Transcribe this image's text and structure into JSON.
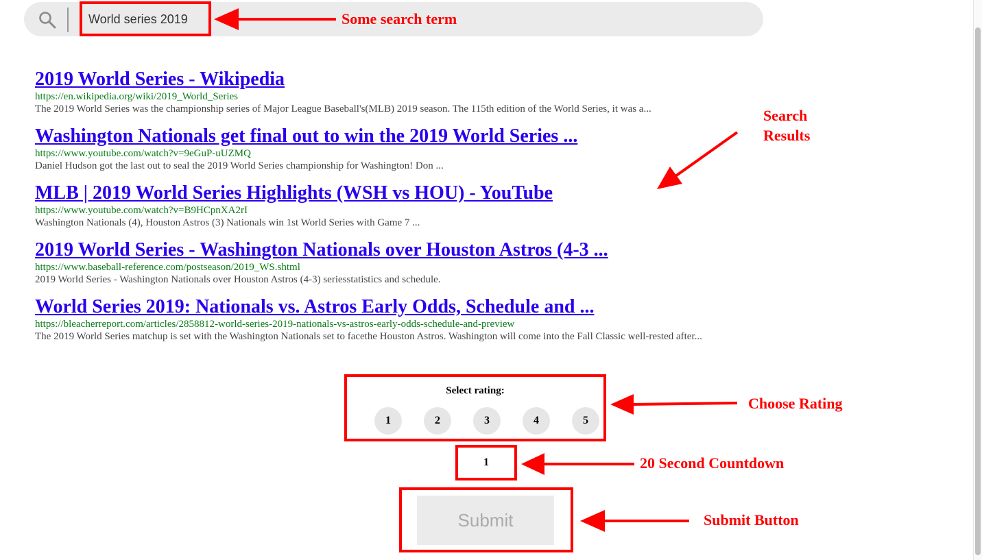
{
  "search": {
    "query": "World series 2019"
  },
  "results": [
    {
      "title": "2019 World Series - Wikipedia",
      "url": "https://en.wikipedia.org/wiki/2019_World_Series",
      "snippet": "The 2019 World Series was the championship series of Major League Baseball's(MLB) 2019 season. The 115th edition of the World Series, it was a..."
    },
    {
      "title": "Washington Nationals get final out to win the 2019 World Series ...",
      "url": "https://www.youtube.com/watch?v=9eGuP-uUZMQ",
      "snippet": "Daniel Hudson got the last out to seal the 2019 World Series championship for Washington! Don ..."
    },
    {
      "title": "MLB | 2019 World Series Highlights (WSH vs HOU) - YouTube",
      "url": "https://www.youtube.com/watch?v=B9HCpnXA2rI",
      "snippet": "Washington Nationals (4), Houston Astros (3) Nationals win 1st World Series with Game 7 ..."
    },
    {
      "title": "2019 World Series - Washington Nationals over Houston Astros (4-3 ...",
      "url": "https://www.baseball-reference.com/postseason/2019_WS.shtml",
      "snippet": "2019 World Series - Washington Nationals over Houston Astros (4-3) seriesstatistics and schedule."
    },
    {
      "title": "World Series 2019: Nationals vs. Astros Early Odds, Schedule and ...",
      "url": "https://bleacherreport.com/articles/2858812-world-series-2019-nationals-vs-astros-early-odds-schedule-and-preview",
      "snippet": "The 2019 World Series matchup is set with the Washington Nationals set to facethe Houston Astros. Washington will come into the Fall Classic well-rested after..."
    }
  ],
  "rating": {
    "label": "Select rating:",
    "options": [
      "1",
      "2",
      "3",
      "4",
      "5"
    ]
  },
  "countdown": {
    "value": "1"
  },
  "submit": {
    "label": "Submit"
  },
  "annotations": {
    "search_term": "Some search term",
    "search_results_line1": "Search",
    "search_results_line2": "Results",
    "choose_rating": "Choose Rating",
    "countdown": "20 Second Countdown",
    "submit_button": "Submit Button",
    "color": "#ff0000"
  },
  "colors": {
    "link": "#2a00ee",
    "url": "#0a7b17",
    "snippet": "#444444",
    "search_bar": "#ebebeb"
  }
}
